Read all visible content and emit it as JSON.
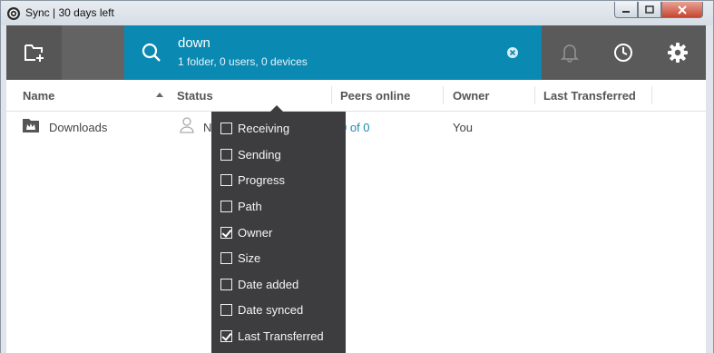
{
  "window": {
    "title": "Sync | 30 days left",
    "app_icon": "sync-logo-icon"
  },
  "toolbar": {
    "add_folder_icon": "add-folder-icon",
    "search": {
      "query": "down",
      "summary": "1 folder, 0 users, 0 devices",
      "clear_icon": "clear-icon"
    },
    "icons": [
      "bell-icon",
      "history-icon",
      "gear-icon"
    ],
    "accent": "#0a8ab3"
  },
  "columns": [
    {
      "label": "Name"
    },
    {
      "label": "Status"
    },
    {
      "label": "Peers online"
    },
    {
      "label": "Owner"
    },
    {
      "label": "Last Transferred"
    }
  ],
  "rows": [
    {
      "name": "Downloads",
      "status": "N",
      "peers": "0 of 0",
      "owner": "You"
    }
  ],
  "column_menu": {
    "items": [
      {
        "label": "Receiving",
        "checked": false
      },
      {
        "label": "Sending",
        "checked": false
      },
      {
        "label": "Progress",
        "checked": false
      },
      {
        "label": "Path",
        "checked": false
      },
      {
        "label": "Owner",
        "checked": true
      },
      {
        "label": "Size",
        "checked": false
      },
      {
        "label": "Date added",
        "checked": false
      },
      {
        "label": "Date synced",
        "checked": false
      },
      {
        "label": "Last Transferred",
        "checked": true
      }
    ]
  }
}
